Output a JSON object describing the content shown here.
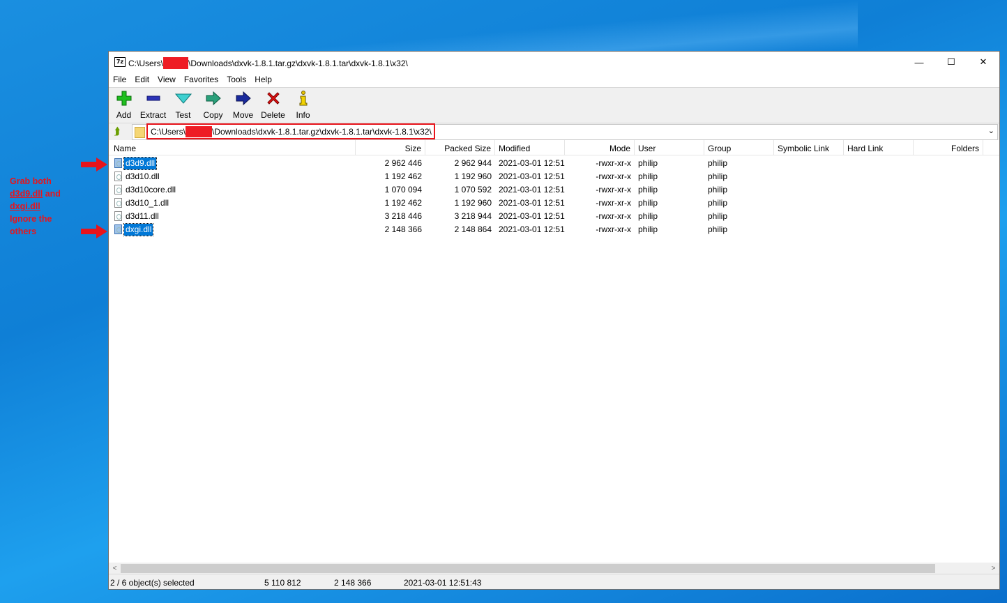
{
  "annotation": {
    "line1": "Grab both",
    "line2a": "d3d9.dll",
    "line2b": " and",
    "line3": "dxgi.dll",
    "line4": "Ignore the",
    "line5": "others",
    "color": "#e8141b"
  },
  "window": {
    "app_icon_text": "7z",
    "title_prefix": "C:\\Users\\",
    "title_suffix": "\\Downloads\\dxvk-1.8.1.tar.gz\\dxvk-1.8.1.tar\\dxvk-1.8.1\\x32\\",
    "minimize": "—",
    "maximize": "☐",
    "close": "✕"
  },
  "menu": [
    "File",
    "Edit",
    "View",
    "Favorites",
    "Tools",
    "Help"
  ],
  "toolbar": {
    "add": "Add",
    "extract": "Extract",
    "test": "Test",
    "copy": "Copy",
    "move": "Move",
    "delete": "Delete",
    "info": "Info"
  },
  "address": {
    "prefix": "C:\\Users\\",
    "suffix": "\\Downloads\\dxvk-1.8.1.tar.gz\\dxvk-1.8.1.tar\\dxvk-1.8.1\\x32\\",
    "dropdown": "⌄"
  },
  "columns": {
    "name": "Name",
    "size": "Size",
    "packed": "Packed Size",
    "modified": "Modified",
    "mode": "Mode",
    "user": "User",
    "group": "Group",
    "symlink": "Symbolic Link",
    "hardlink": "Hard Link",
    "folders": "Folders"
  },
  "files": [
    {
      "name": "d3d9.dll",
      "size": "2 962 446",
      "packed": "2 962 944",
      "modified": "2021-03-01 12:51",
      "mode": "-rwxr-xr-x",
      "user": "philip",
      "group": "philip",
      "selected": true
    },
    {
      "name": "d3d10.dll",
      "size": "1 192 462",
      "packed": "1 192 960",
      "modified": "2021-03-01 12:51",
      "mode": "-rwxr-xr-x",
      "user": "philip",
      "group": "philip",
      "selected": false
    },
    {
      "name": "d3d10core.dll",
      "size": "1 070 094",
      "packed": "1 070 592",
      "modified": "2021-03-01 12:51",
      "mode": "-rwxr-xr-x",
      "user": "philip",
      "group": "philip",
      "selected": false
    },
    {
      "name": "d3d10_1.dll",
      "size": "1 192 462",
      "packed": "1 192 960",
      "modified": "2021-03-01 12:51",
      "mode": "-rwxr-xr-x",
      "user": "philip",
      "group": "philip",
      "selected": false
    },
    {
      "name": "d3d11.dll",
      "size": "3 218 446",
      "packed": "3 218 944",
      "modified": "2021-03-01 12:51",
      "mode": "-rwxr-xr-x",
      "user": "philip",
      "group": "philip",
      "selected": false
    },
    {
      "name": "dxgi.dll",
      "size": "2 148 366",
      "packed": "2 148 864",
      "modified": "2021-03-01 12:51",
      "mode": "-rwxr-xr-x",
      "user": "philip",
      "group": "philip",
      "selected": true
    }
  ],
  "scroll": {
    "left": "<",
    "right": ">"
  },
  "status": {
    "selection": "2 / 6 object(s) selected",
    "total_size": "5 110 812",
    "selected_size": "2 148 366",
    "modified": "2021-03-01 12:51:43"
  }
}
